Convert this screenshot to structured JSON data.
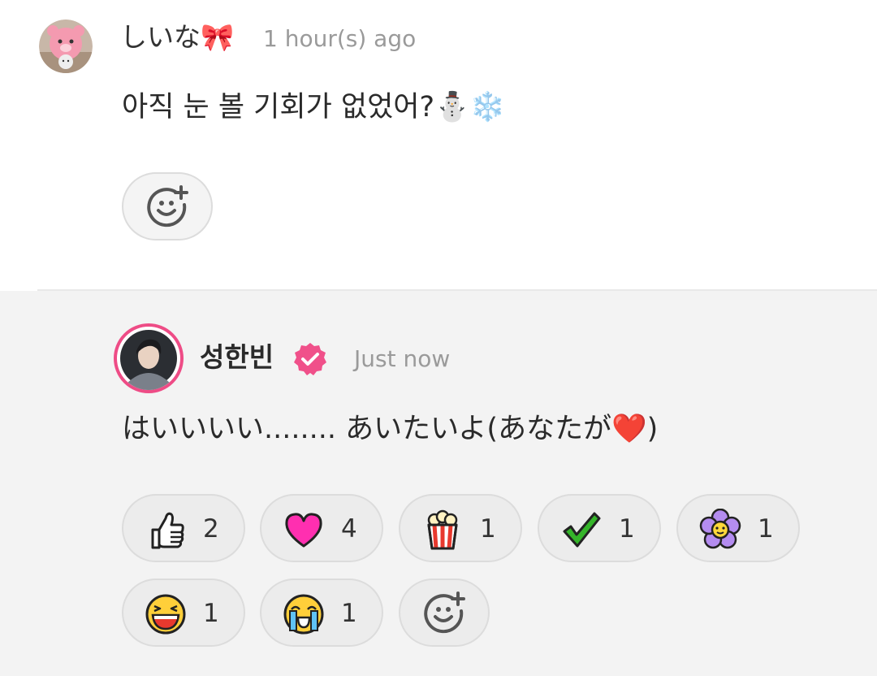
{
  "comments": [
    {
      "author": "しいな🎀",
      "time": "1 hour(s) ago",
      "text": "아직 눈 볼 기회가 없었어?⛄❄️",
      "avatar": "pink-bear-avatar"
    },
    {
      "author": "성한빈",
      "verified_icon": "verified-badge-icon",
      "time": "Just now",
      "text": "はいいいい........ あいたいよ(あなたが❤️)",
      "avatar": "user-photo-avatar",
      "reactions": [
        {
          "icon": "thumbs-up-icon",
          "count": "2"
        },
        {
          "icon": "heart-icon",
          "count": "4"
        },
        {
          "icon": "popcorn-icon",
          "count": "1"
        },
        {
          "icon": "checkmark-icon",
          "count": "1"
        },
        {
          "icon": "flower-icon",
          "count": "1"
        },
        {
          "icon": "laughing-face-icon",
          "count": "1"
        },
        {
          "icon": "crying-face-icon",
          "count": "1"
        }
      ]
    }
  ],
  "colors": {
    "verified_badge": "#f0508a",
    "avatar_ring": "#ee4c86",
    "heart": "#ff2fb0",
    "check": "#35b52a",
    "flower": "#b48cf0",
    "popcorn_red": "#e8392e"
  }
}
